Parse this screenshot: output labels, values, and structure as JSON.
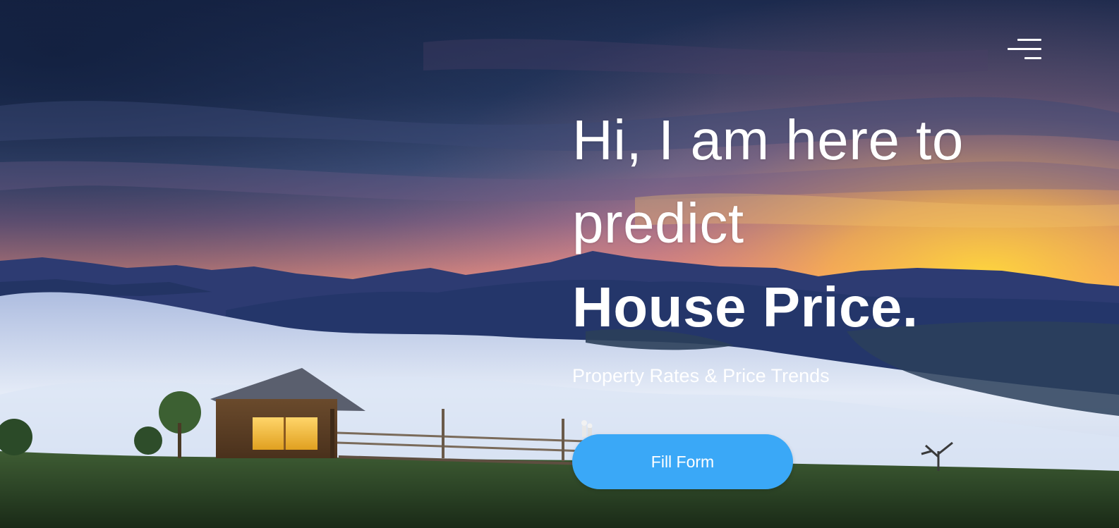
{
  "hero": {
    "headline_line1": "Hi, I am here to",
    "headline_line2": "predict",
    "headline_emphasis": "House Price.",
    "subtitle": "Property Rates & Price Trends",
    "cta_label": "Fill Form"
  },
  "nav": {
    "menu_icon": "hamburger-menu-icon"
  },
  "colors": {
    "cta_background": "#3aa8f7",
    "text": "#ffffff"
  }
}
